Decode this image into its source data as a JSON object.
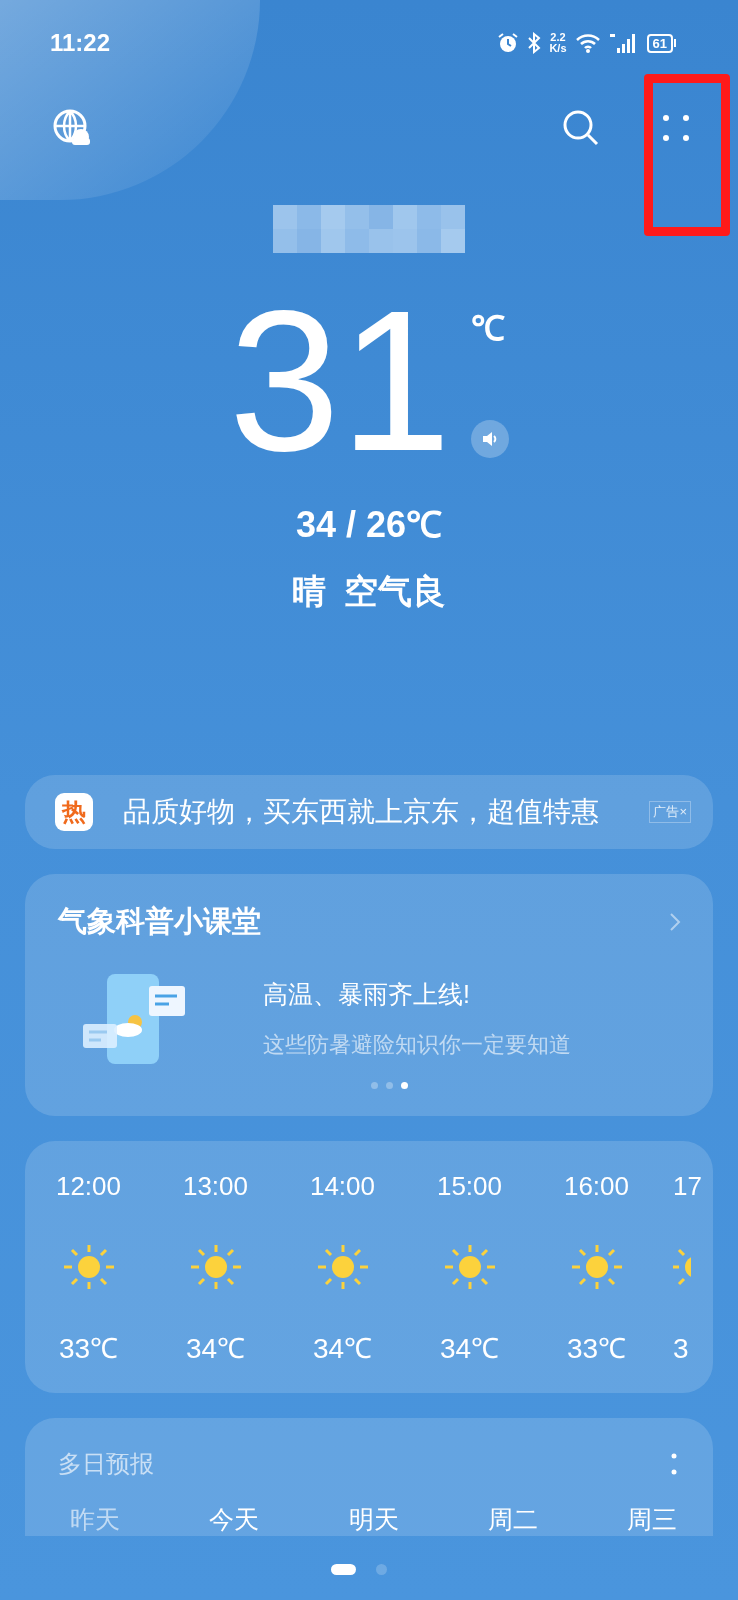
{
  "status_bar": {
    "time": "11:22",
    "speed": "2.2\nK/s",
    "battery": "61"
  },
  "current": {
    "temperature": "31",
    "unit": "℃",
    "range": "34 / 26℃",
    "condition": "晴  空气良"
  },
  "ad": {
    "badge": "热",
    "text": "品质好物，买东西就上京东，超值特惠",
    "label": "广告",
    "close": "×"
  },
  "science_card": {
    "title": "气象科普小课堂",
    "headline": "高温、暴雨齐上线!",
    "subtitle": "这些防暑避险知识你一定要知道",
    "dots": [
      {
        "selected": false
      },
      {
        "selected": false
      },
      {
        "selected": true
      }
    ]
  },
  "hourly": [
    {
      "time": "12:00",
      "temp": "33℃"
    },
    {
      "time": "13:00",
      "temp": "34℃"
    },
    {
      "time": "14:00",
      "temp": "34℃"
    },
    {
      "time": "15:00",
      "temp": "34℃"
    },
    {
      "time": "16:00",
      "temp": "33℃"
    },
    {
      "time": "17",
      "temp": "3"
    }
  ],
  "daily": {
    "title": "多日预报",
    "days": [
      {
        "label": "昨天",
        "past": true
      },
      {
        "label": "今天",
        "past": false
      },
      {
        "label": "明天",
        "past": false
      },
      {
        "label": "周二",
        "past": false
      },
      {
        "label": "周三",
        "past": false
      }
    ]
  },
  "pages": [
    {
      "selected": true
    },
    {
      "selected": false
    }
  ]
}
